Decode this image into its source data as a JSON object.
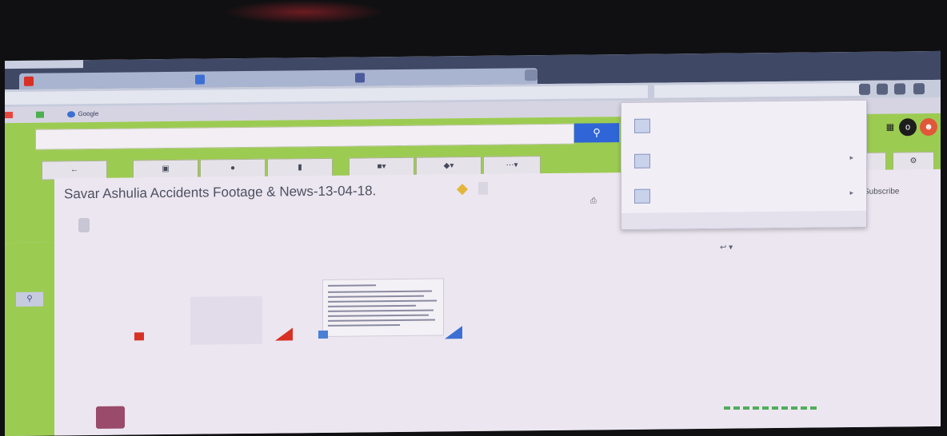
{
  "browser": {
    "window_label": "",
    "tabs": [
      {
        "label": "",
        "favicon_color": "#d93025"
      },
      {
        "label": "",
        "favicon_color": "#3b6fd4"
      },
      {
        "label": "",
        "favicon_color": "#4a5a9a"
      }
    ],
    "url": "",
    "search_placeholder": "",
    "bookmarks": [
      {
        "label": "",
        "color": "#e8453c"
      },
      {
        "label": "",
        "color": "#4caf50"
      },
      {
        "label": "Google",
        "color": "#3b6fd4"
      }
    ]
  },
  "gmail": {
    "search_button": "search-icon",
    "toolbar": {
      "back": "",
      "archive": "",
      "spam": "",
      "delete": "",
      "move": "",
      "labels": "",
      "more": ""
    },
    "right_icons": [
      "apps-icon",
      "notifications-icon",
      "avatar-icon"
    ],
    "message": {
      "subject": "Savar Ashulia Accidents Footage & News-13-04-18.",
      "inbox_chip": "",
      "sender_name": "",
      "sender_email": "",
      "to_line": "",
      "body": "",
      "attachments_title": "",
      "attachments": [
        {
          "name": "",
          "icon_color": "#d93025",
          "corner_color": "#d93025"
        },
        {
          "name": "",
          "icon_color": "#4a7fd6",
          "corner_color": "#3b6fd4"
        }
      ],
      "unsubscribe": "Subscribe",
      "reply_link": ""
    },
    "thread": [
      {
        "from": "",
        "snippet": "",
        "date": ""
      },
      {
        "from": "",
        "snippet": "",
        "date": ""
      },
      {
        "from": "",
        "snippet": "",
        "date": ""
      }
    ],
    "attachment_date": ""
  },
  "downloads": {
    "items": [
      {
        "name": "",
        "meta": ""
      },
      {
        "name": "",
        "meta": ""
      },
      {
        "name": "",
        "meta": ""
      }
    ],
    "footer": ""
  },
  "colors": {
    "gmail_green": "#9ccb52",
    "search_blue": "#2f65d6",
    "panel_bg": "#ece6f0"
  }
}
